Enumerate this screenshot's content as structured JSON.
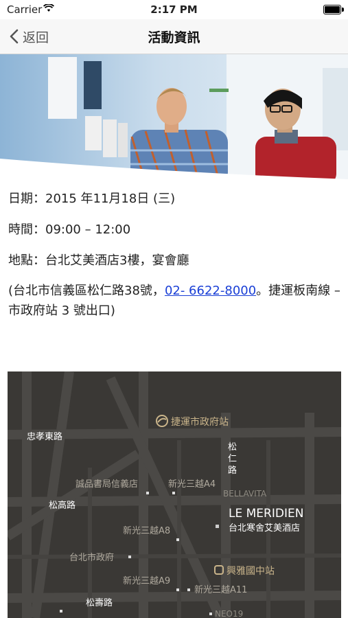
{
  "status_bar": {
    "carrier": "Carrier",
    "time": "2:17 PM"
  },
  "nav": {
    "back_label": "返回",
    "title": "活動資訊"
  },
  "event": {
    "date_label": "日期：",
    "date_value": "2015 年11月18日 (三)",
    "time_label": "時間：",
    "time_value": "09:00 – 12:00",
    "place_label": "地點：",
    "place_value": "台北艾美酒店3樓，宴會廳",
    "address_prefix": "(台北市信義區松仁路38號，",
    "phone": "02- 6622-8000",
    "address_suffix": "。捷運板南線 – 市政府站 3 號出口)"
  },
  "map": {
    "mrt_station": "捷運市政府站",
    "road_zhongxiao": "忠孝東路",
    "road_songren": "松仁路",
    "road_songgao": "松高路",
    "road_songshou": "松壽路",
    "eslite": "誠品書局信義店",
    "skm_a4": "新光三越A4",
    "bellavita": "BELLAVITA",
    "hotel_en": "LE MERIDIEN",
    "hotel_zh": "台北寒舍艾美酒店",
    "skm_a8": "新光三越A8",
    "city_hall": "台北市政府",
    "skm_a9": "新光三越A9",
    "bus_station": "興雅國中站",
    "skm_a11": "新光三越A11",
    "neo19": "NEO19"
  },
  "colors": {
    "link": "#1a3fd6",
    "map_bg": "#3a3835",
    "map_gold": "#c9b48a"
  }
}
